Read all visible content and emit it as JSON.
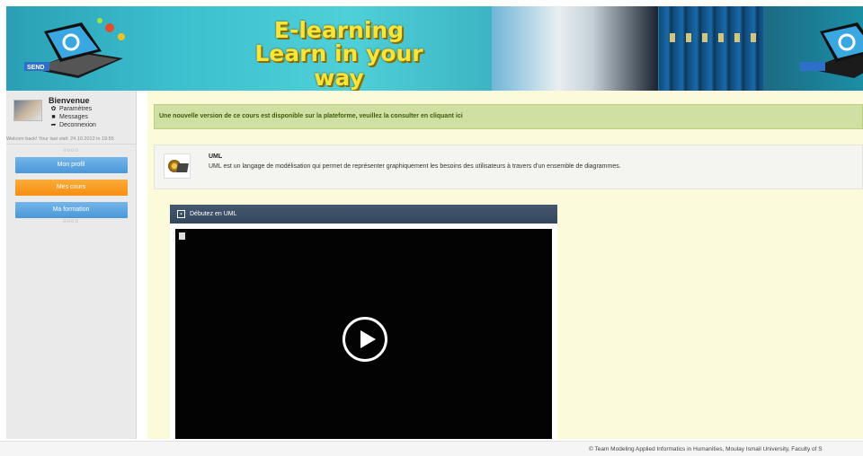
{
  "banner": {
    "title_line1": "E-learning",
    "title_line2": "Learn in your way",
    "send_label": "SEND"
  },
  "sidebar": {
    "welcome": "Bienvenue",
    "menu": [
      {
        "label": "Paramètres",
        "icon": "gear-icon"
      },
      {
        "label": "Messages",
        "icon": "message-icon"
      },
      {
        "label": "Deconnexion",
        "icon": "logout-icon"
      }
    ],
    "last_visit": "Welcom back! Your last visit: 24.10.2012 in 19:55",
    "separator": "oooo",
    "nav": [
      {
        "label": "Mon profil",
        "color": "#4a97d8"
      },
      {
        "label": "Mes cours",
        "color": "#f58f10"
      },
      {
        "label": "Ma formation",
        "color": "#4a97d8"
      }
    ]
  },
  "main": {
    "notice": "Une nouvelle version de ce cours est disponible sur la plateforme, veuillez la consulter en cliquant ici",
    "course": {
      "title": "UML",
      "description": "UML est un langage de modélisation qui permet de représenter graphiquement les besoins des utilisateurs à travers d'un ensemble de diagrammes."
    },
    "video": {
      "title": "Débutez en UML"
    }
  },
  "footer": {
    "text": "© Team Modeling Applied Informatics in Humanities, Moulay Ismail University, Faculty of S"
  }
}
